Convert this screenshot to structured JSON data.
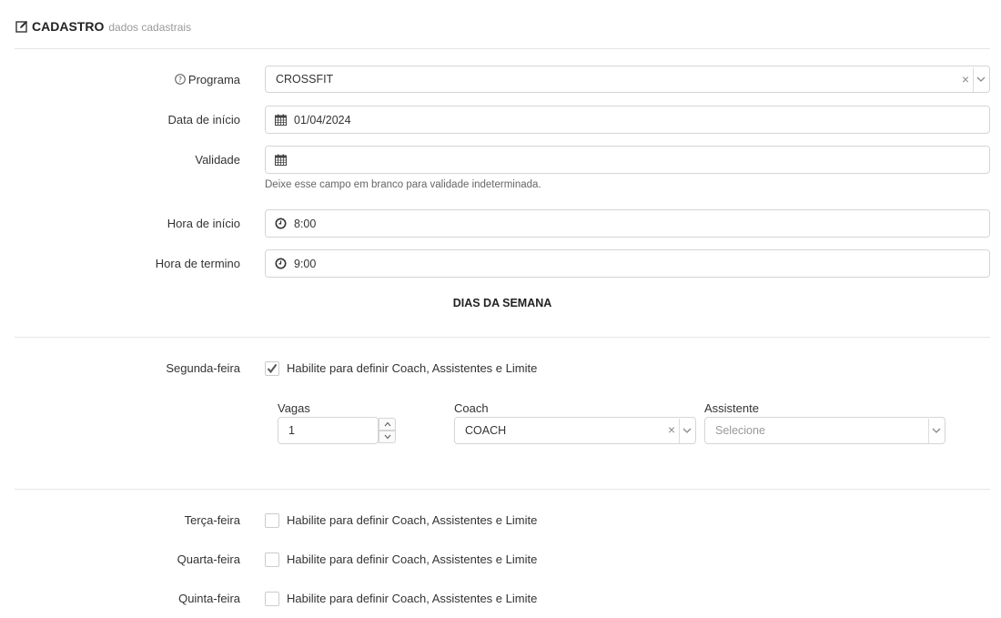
{
  "header": {
    "title": "CADASTRO",
    "subtitle": "dados cadastrais",
    "icon": "edit-icon"
  },
  "form": {
    "programa": {
      "label": "Programa",
      "value": "CROSSFIT"
    },
    "data_inicio": {
      "label": "Data de início",
      "value": "01/04/2024"
    },
    "validade": {
      "label": "Validade",
      "value": "",
      "help": "Deixe esse campo em branco para validade indeterminada."
    },
    "hora_inicio": {
      "label": "Hora de início",
      "value": "8:00"
    },
    "hora_termino": {
      "label": "Hora de termino",
      "value": "9:00"
    }
  },
  "dias": {
    "title": "DIAS DA SEMANA",
    "checkbox_label": "Habilite para definir Coach, Assistentes e Limite",
    "segunda": {
      "label": "Segunda-feira",
      "checked": true
    },
    "terca": {
      "label": "Terça-feira",
      "checked": false
    },
    "quarta": {
      "label": "Quarta-feira",
      "checked": false
    },
    "quinta": {
      "label": "Quinta-feira",
      "checked": false
    },
    "detalhes": {
      "vagas_label": "Vagas",
      "vagas_value": "1",
      "coach_label": "Coach",
      "coach_value": "COACH",
      "assistente_label": "Assistente",
      "assistente_placeholder": "Selecione"
    }
  }
}
